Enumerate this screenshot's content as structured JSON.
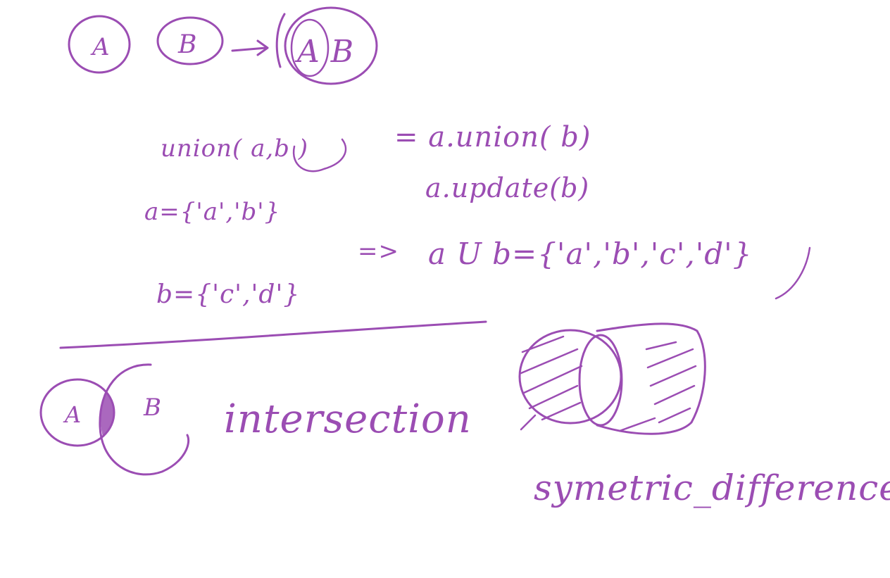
{
  "colors": {
    "ink": "#9b4db3",
    "background": "#ffffff"
  },
  "top_row": {
    "circle_a_label": "A",
    "circle_b_label": "B",
    "arrow": "→",
    "combined_label": "A B"
  },
  "notes": {
    "union_call": "union( a,b )",
    "equals_method": "= a.union( b)",
    "update_method": "a.update(b)",
    "set_a": "a={'a','b'}",
    "set_b": "b={'c','d'}",
    "implies": "=>",
    "result": "a U b={'a','b','c','d'}"
  },
  "venn_intersection": {
    "label_a": "A",
    "label_b": "B",
    "caption": "intersection"
  },
  "venn_symmetric": {
    "caption": "symetric_difference"
  }
}
